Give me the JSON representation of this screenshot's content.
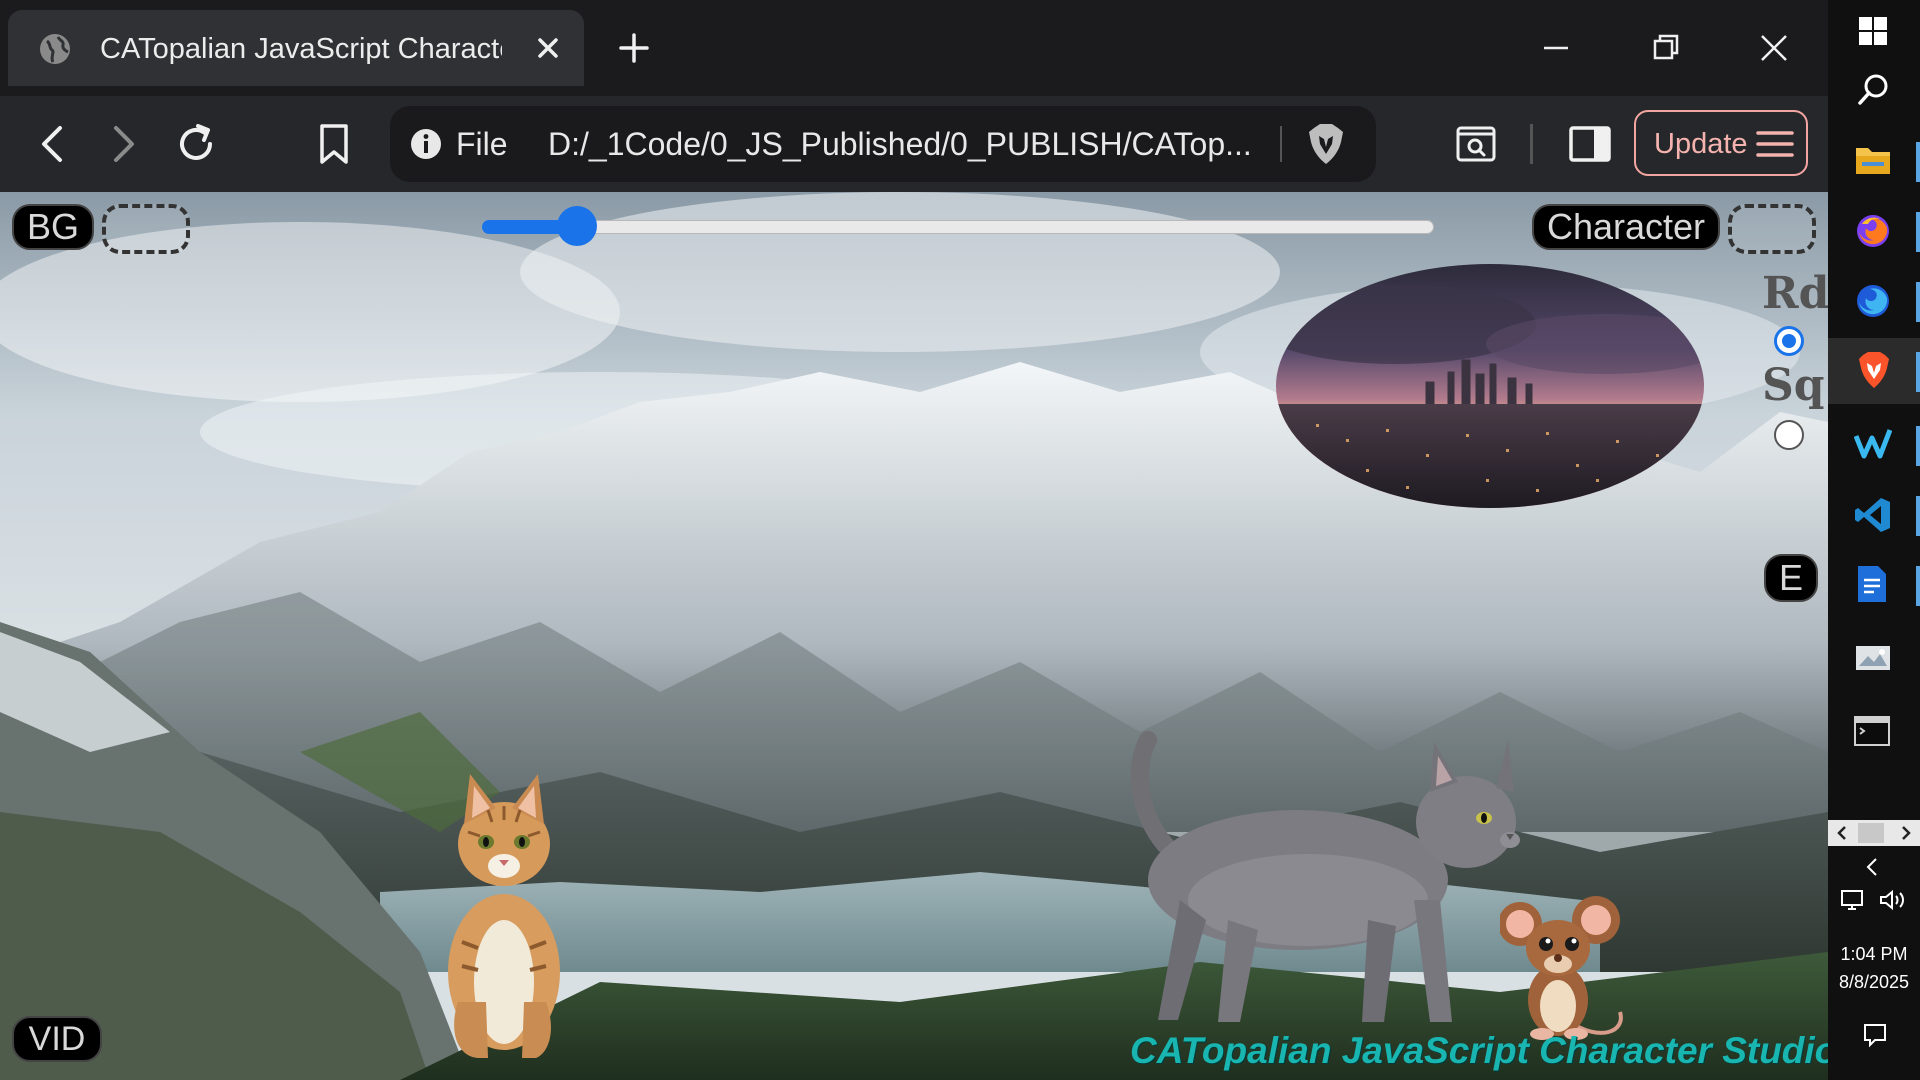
{
  "browser": {
    "tab": {
      "title": "CATopalian JavaScript Character Studio"
    },
    "omnibox": {
      "scheme_label": "File",
      "url": "D:/_1Code/0_JS_Published/0_PUBLISH/CATop..."
    },
    "update_button": {
      "label": "Update"
    }
  },
  "page": {
    "bg_button": {
      "label": "BG"
    },
    "character_button": {
      "label": "Character"
    },
    "size_slider": {
      "value_fraction": 0.1
    },
    "shape_options": [
      {
        "label": "Rd",
        "checked": true
      },
      {
        "label": "Sq",
        "checked": false
      }
    ],
    "e_button": {
      "label": "E"
    },
    "vid_button": {
      "label": "VID"
    },
    "studio_title": "CATopalian JavaScript Character Studio"
  },
  "taskbar": {
    "apps": [
      {
        "icon": "windows-start-icon"
      },
      {
        "icon": "search-icon"
      },
      {
        "icon": "file-explorer-icon",
        "running": true
      },
      {
        "icon": "firefox-icon",
        "running": true
      },
      {
        "icon": "firefox-developer-icon",
        "running": true
      },
      {
        "icon": "brave-browser-icon",
        "running": true,
        "active": true
      },
      {
        "icon": "windsurf-icon",
        "running": true
      },
      {
        "icon": "vscode-icon",
        "running": true
      },
      {
        "icon": "document-editor-icon",
        "running": true
      },
      {
        "icon": "image-viewer-icon"
      },
      {
        "icon": "terminal-icon"
      }
    ],
    "clock": {
      "time": "1:04 PM",
      "date": "8/8/2025"
    }
  },
  "colors": {
    "accent_blue": "#1a73e8",
    "update_button": "#f2a5a1",
    "studio_title": "#19b5b0"
  }
}
